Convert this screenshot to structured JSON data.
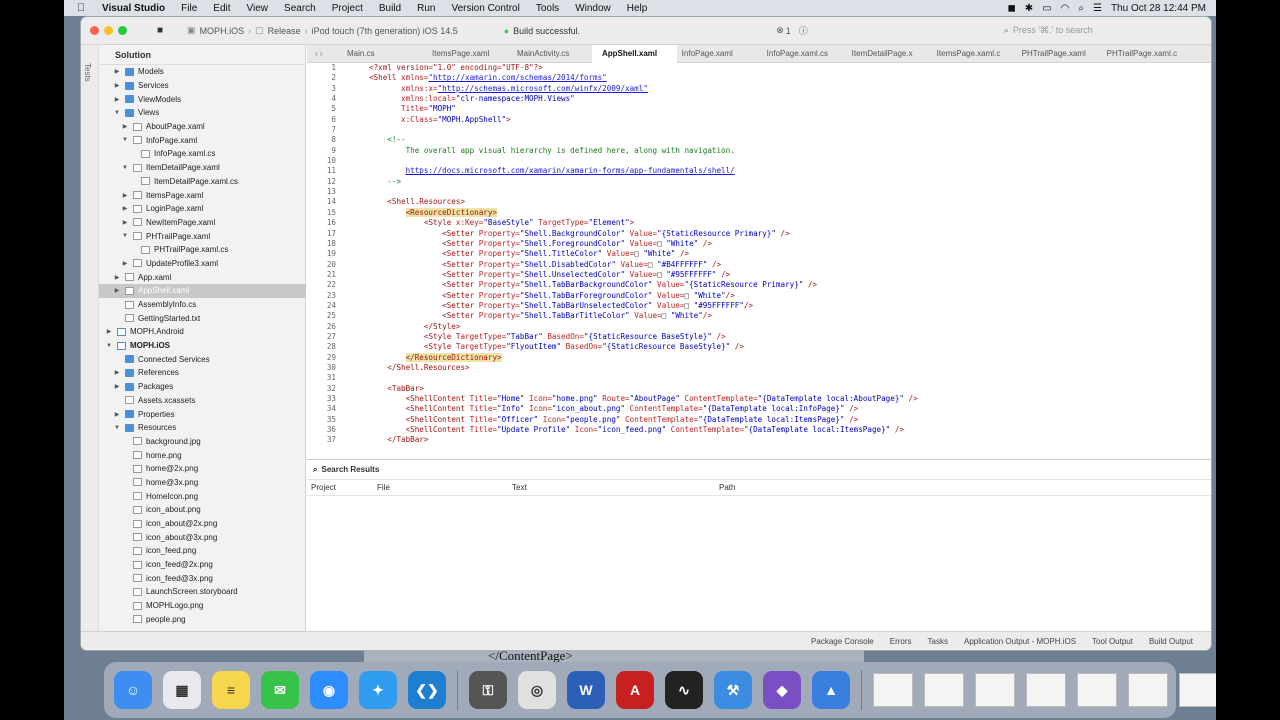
{
  "menubar": {
    "items": [
      "Visual Studio",
      "File",
      "Edit",
      "View",
      "Search",
      "Project",
      "Build",
      "Run",
      "Version Control",
      "Tools",
      "Window",
      "Help"
    ],
    "clock": "Thu Oct 28  12:44 PM"
  },
  "toolbar": {
    "project": "MOPH.iOS",
    "config": "Release",
    "device": "iPod touch (7th generation) iOS 14.5",
    "status": "Build successful.",
    "errors": "1",
    "search_placeholder": "Press '⌘.' to search"
  },
  "sidebar": {
    "vtab": "Tests",
    "title": "Solution",
    "tree": [
      {
        "label": "Models",
        "level": 1,
        "type": "folder",
        "arrow": "right"
      },
      {
        "label": "Services",
        "level": 1,
        "type": "folder",
        "arrow": "right"
      },
      {
        "label": "ViewModels",
        "level": 1,
        "type": "folder",
        "arrow": "right"
      },
      {
        "label": "Views",
        "level": 1,
        "type": "folder",
        "arrow": "down"
      },
      {
        "label": "AboutPage.xaml",
        "level": 2,
        "type": "file",
        "arrow": "right"
      },
      {
        "label": "InfoPage.xaml",
        "level": 2,
        "type": "file",
        "arrow": "down"
      },
      {
        "label": "InfoPage.xaml.cs",
        "level": 3,
        "type": "file",
        "arrow": ""
      },
      {
        "label": "ItemDetailPage.xaml",
        "level": 2,
        "type": "file",
        "arrow": "down"
      },
      {
        "label": "ItemDetailPage.xaml.cs",
        "level": 3,
        "type": "file",
        "arrow": ""
      },
      {
        "label": "ItemsPage.xaml",
        "level": 2,
        "type": "file",
        "arrow": "right"
      },
      {
        "label": "LoginPage.xaml",
        "level": 2,
        "type": "file",
        "arrow": "right"
      },
      {
        "label": "NewItemPage.xaml",
        "level": 2,
        "type": "file",
        "arrow": "right"
      },
      {
        "label": "PHTrailPage.xaml",
        "level": 2,
        "type": "file",
        "arrow": "down"
      },
      {
        "label": "PHTrailPage.xaml.cs",
        "level": 3,
        "type": "file",
        "arrow": ""
      },
      {
        "label": "UpdateProfile3.xaml",
        "level": 2,
        "type": "file",
        "arrow": "right"
      },
      {
        "label": "App.xaml",
        "level": 1,
        "type": "file",
        "arrow": "right"
      },
      {
        "label": "AppShell.xaml",
        "level": 1,
        "type": "file",
        "arrow": "right",
        "selected": true
      },
      {
        "label": "AssemblyInfo.cs",
        "level": 1,
        "type": "file",
        "arrow": ""
      },
      {
        "label": "GettingStarted.txt",
        "level": 1,
        "type": "file",
        "arrow": ""
      },
      {
        "label": "MOPH.Android",
        "level": 0,
        "type": "proj",
        "arrow": "right"
      },
      {
        "label": "MOPH.iOS",
        "level": 0,
        "type": "proj",
        "arrow": "down",
        "bold": true
      },
      {
        "label": "Connected Services",
        "level": 1,
        "type": "folder",
        "arrow": ""
      },
      {
        "label": "References",
        "level": 1,
        "type": "folder",
        "arrow": "right"
      },
      {
        "label": "Packages",
        "level": 1,
        "type": "folder",
        "arrow": "right"
      },
      {
        "label": "Assets.xcassets",
        "level": 1,
        "type": "file",
        "arrow": ""
      },
      {
        "label": "Properties",
        "level": 1,
        "type": "folder",
        "arrow": "right"
      },
      {
        "label": "Resources",
        "level": 1,
        "type": "folder",
        "arrow": "down"
      },
      {
        "label": "background.jpg",
        "level": 2,
        "type": "file",
        "arrow": ""
      },
      {
        "label": "home.png",
        "level": 2,
        "type": "file",
        "arrow": ""
      },
      {
        "label": "home@2x.png",
        "level": 2,
        "type": "file",
        "arrow": ""
      },
      {
        "label": "home@3x.png",
        "level": 2,
        "type": "file",
        "arrow": ""
      },
      {
        "label": "HomeIcon.png",
        "level": 2,
        "type": "file",
        "arrow": ""
      },
      {
        "label": "icon_about.png",
        "level": 2,
        "type": "file",
        "arrow": ""
      },
      {
        "label": "icon_about@2x.png",
        "level": 2,
        "type": "file",
        "arrow": ""
      },
      {
        "label": "icon_about@3x.png",
        "level": 2,
        "type": "file",
        "arrow": ""
      },
      {
        "label": "icon_feed.png",
        "level": 2,
        "type": "file",
        "arrow": ""
      },
      {
        "label": "icon_feed@2x.png",
        "level": 2,
        "type": "file",
        "arrow": ""
      },
      {
        "label": "icon_feed@3x.png",
        "level": 2,
        "type": "file",
        "arrow": ""
      },
      {
        "label": "LaunchScreen.storyboard",
        "level": 2,
        "type": "file",
        "arrow": ""
      },
      {
        "label": "MOPHLogo.png",
        "level": 2,
        "type": "file",
        "arrow": ""
      },
      {
        "label": "people.png",
        "level": 2,
        "type": "file",
        "arrow": ""
      }
    ]
  },
  "tabs": [
    {
      "label": "Main.cs"
    },
    {
      "label": "ItemsPage.xaml"
    },
    {
      "label": "MainActivity.cs"
    },
    {
      "label": "AppShell.xaml",
      "active": true
    },
    {
      "label": "InfoPage.xaml"
    },
    {
      "label": "InfoPage.xaml.cs"
    },
    {
      "label": "ItemDetailPage.x"
    },
    {
      "label": "ItemsPage.xaml.c"
    },
    {
      "label": "PHTrailPage.xaml"
    },
    {
      "label": "PHTrailPage.xaml.c"
    }
  ],
  "code": [
    {
      "n": "1",
      "i": 0,
      "s": [
        [
          "t",
          "<?xml version=\"1.0\" encoding=\"UTF-8\"?>"
        ]
      ]
    },
    {
      "n": "2",
      "i": 0,
      "s": [
        [
          "t",
          "<Shell "
        ],
        [
          "a",
          "xmlns="
        ],
        [
          "u",
          "\"http://xamarin.com/schemas/2014/forms\""
        ]
      ]
    },
    {
      "n": "3",
      "i": 7,
      "s": [
        [
          "a",
          "xmlns:x="
        ],
        [
          "u",
          "\"http://schemas.microsoft.com/winfx/2009/xaml\""
        ]
      ]
    },
    {
      "n": "4",
      "i": 7,
      "s": [
        [
          "a",
          "xmlns:local="
        ],
        [
          "v",
          "\"clr-namespace:MOPH.Views\""
        ]
      ]
    },
    {
      "n": "5",
      "i": 7,
      "s": [
        [
          "a",
          "Title="
        ],
        [
          "v",
          "\"MOPH\""
        ]
      ]
    },
    {
      "n": "6",
      "i": 7,
      "s": [
        [
          "a",
          "x:Class="
        ],
        [
          "v",
          "\"MOPH.AppShell\""
        ],
        [
          "t",
          ">"
        ]
      ]
    },
    {
      "n": "7",
      "i": 0,
      "s": []
    },
    {
      "n": "8",
      "i": 4,
      "s": [
        [
          "c",
          "<!--"
        ]
      ]
    },
    {
      "n": "9",
      "i": 8,
      "s": [
        [
          "c",
          "The overall app visual hierarchy is defined here, along with navigation."
        ]
      ]
    },
    {
      "n": "10",
      "i": 0,
      "s": []
    },
    {
      "n": "11",
      "i": 8,
      "s": [
        [
          "u",
          "https://docs.microsoft.com/xamarin/xamarin-forms/app-fundamentals/shell/"
        ]
      ]
    },
    {
      "n": "12",
      "i": 4,
      "s": [
        [
          "c",
          "-->"
        ]
      ]
    },
    {
      "n": "13",
      "i": 0,
      "s": []
    },
    {
      "n": "14",
      "i": 4,
      "s": [
        [
          "t",
          "<Shell.Resources>"
        ]
      ]
    },
    {
      "n": "15",
      "i": 8,
      "s": [
        [
          "h",
          "<ResourceDictionary>"
        ]
      ]
    },
    {
      "n": "16",
      "i": 12,
      "s": [
        [
          "t",
          "<Style "
        ],
        [
          "a",
          "x:Key="
        ],
        [
          "v",
          "\"BaseStyle\" "
        ],
        [
          "a",
          "TargetType="
        ],
        [
          "v",
          "\"Element\""
        ],
        [
          "t",
          ">"
        ]
      ]
    },
    {
      "n": "17",
      "i": 16,
      "s": [
        [
          "t",
          "<Setter "
        ],
        [
          "a",
          "Property="
        ],
        [
          "v",
          "\"Shell.BackgroundColor\" "
        ],
        [
          "a",
          "Value="
        ],
        [
          "v",
          "\"{StaticResource Primary}\" "
        ],
        [
          "t",
          "/>"
        ]
      ]
    },
    {
      "n": "18",
      "i": 16,
      "s": [
        [
          "t",
          "<Setter "
        ],
        [
          "a",
          "Property="
        ],
        [
          "v",
          "\"Shell.ForegroundColor\" "
        ],
        [
          "a",
          "Value="
        ],
        [
          "p",
          "□ "
        ],
        [
          "v",
          "\"White\" "
        ],
        [
          "t",
          "/>"
        ]
      ]
    },
    {
      "n": "19",
      "i": 16,
      "s": [
        [
          "t",
          "<Setter "
        ],
        [
          "a",
          "Property="
        ],
        [
          "v",
          "\"Shell.TitleColor\" "
        ],
        [
          "a",
          "Value="
        ],
        [
          "p",
          "□ "
        ],
        [
          "v",
          "\"White\" "
        ],
        [
          "t",
          "/>"
        ]
      ]
    },
    {
      "n": "20",
      "i": 16,
      "s": [
        [
          "t",
          "<Setter "
        ],
        [
          "a",
          "Property="
        ],
        [
          "v",
          "\"Shell.DisabledColor\" "
        ],
        [
          "a",
          "Value="
        ],
        [
          "p",
          "□ "
        ],
        [
          "v",
          "\"#B4FFFFFF\" "
        ],
        [
          "t",
          "/>"
        ]
      ]
    },
    {
      "n": "21",
      "i": 16,
      "s": [
        [
          "t",
          "<Setter "
        ],
        [
          "a",
          "Property="
        ],
        [
          "v",
          "\"Shell.UnselectedColor\" "
        ],
        [
          "a",
          "Value="
        ],
        [
          "p",
          "□ "
        ],
        [
          "v",
          "\"#95FFFFFF\" "
        ],
        [
          "t",
          "/>"
        ]
      ]
    },
    {
      "n": "22",
      "i": 16,
      "s": [
        [
          "t",
          "<Setter "
        ],
        [
          "a",
          "Property="
        ],
        [
          "v",
          "\"Shell.TabBarBackgroundColor\" "
        ],
        [
          "a",
          "Value="
        ],
        [
          "v",
          "\"{StaticResource Primary}\" "
        ],
        [
          "t",
          "/>"
        ]
      ]
    },
    {
      "n": "23",
      "i": 16,
      "s": [
        [
          "t",
          "<Setter "
        ],
        [
          "a",
          "Property="
        ],
        [
          "v",
          "\"Shell.TabBarForegroundColor\" "
        ],
        [
          "a",
          "Value="
        ],
        [
          "p",
          "□ "
        ],
        [
          "v",
          "\"White\""
        ],
        [
          "t",
          "/>"
        ]
      ]
    },
    {
      "n": "24",
      "i": 16,
      "s": [
        [
          "t",
          "<Setter "
        ],
        [
          "a",
          "Property="
        ],
        [
          "v",
          "\"Shell.TabBarUnselectedColor\" "
        ],
        [
          "a",
          "Value="
        ],
        [
          "p",
          "□ "
        ],
        [
          "v",
          "\"#95FFFFFF\""
        ],
        [
          "t",
          "/>"
        ]
      ]
    },
    {
      "n": "25",
      "i": 16,
      "s": [
        [
          "t",
          "<Setter "
        ],
        [
          "a",
          "Property="
        ],
        [
          "v",
          "\"Shell.TabBarTitleColor\" "
        ],
        [
          "a",
          "Value="
        ],
        [
          "p",
          "□ "
        ],
        [
          "v",
          "\"White\""
        ],
        [
          "t",
          "/>"
        ]
      ]
    },
    {
      "n": "26",
      "i": 12,
      "s": [
        [
          "t",
          "</Style>"
        ]
      ]
    },
    {
      "n": "27",
      "i": 12,
      "s": [
        [
          "t",
          "<Style "
        ],
        [
          "a",
          "TargetType="
        ],
        [
          "v",
          "\"TabBar\" "
        ],
        [
          "a",
          "BasedOn="
        ],
        [
          "v",
          "\"{StaticResource BaseStyle}\" "
        ],
        [
          "t",
          "/>"
        ]
      ]
    },
    {
      "n": "28",
      "i": 12,
      "s": [
        [
          "t",
          "<Style "
        ],
        [
          "a",
          "TargetType="
        ],
        [
          "v",
          "\"FlyoutItem\" "
        ],
        [
          "a",
          "BasedOn="
        ],
        [
          "v",
          "\"{StaticResource BaseStyle}\" "
        ],
        [
          "t",
          "/>"
        ]
      ]
    },
    {
      "n": "29",
      "i": 8,
      "s": [
        [
          "h",
          "</ResourceDictionary>"
        ]
      ]
    },
    {
      "n": "30",
      "i": 4,
      "s": [
        [
          "t",
          "</Shell.Resources>"
        ]
      ]
    },
    {
      "n": "31",
      "i": 0,
      "s": []
    },
    {
      "n": "32",
      "i": 4,
      "s": [
        [
          "t",
          "<TabBar>"
        ]
      ]
    },
    {
      "n": "33",
      "i": 8,
      "s": [
        [
          "t",
          "<ShellContent "
        ],
        [
          "a",
          "Title="
        ],
        [
          "v",
          "\"Home\" "
        ],
        [
          "a",
          "Icon="
        ],
        [
          "v",
          "\"home.png\" "
        ],
        [
          "a",
          "Route="
        ],
        [
          "v",
          "\"AboutPage\" "
        ],
        [
          "a",
          "ContentTemplate="
        ],
        [
          "v",
          "\"{DataTemplate local:AboutPage}\" "
        ],
        [
          "t",
          "/>"
        ]
      ]
    },
    {
      "n": "34",
      "i": 8,
      "s": [
        [
          "t",
          "<ShellContent "
        ],
        [
          "a",
          "Title="
        ],
        [
          "v",
          "\"Info\" "
        ],
        [
          "a",
          "Icon="
        ],
        [
          "v",
          "\"icon_about.png\" "
        ],
        [
          "a",
          "ContentTemplate="
        ],
        [
          "v",
          "\"{DataTemplate local:InfoPage}\" "
        ],
        [
          "t",
          "/>"
        ]
      ]
    },
    {
      "n": "35",
      "i": 8,
      "s": [
        [
          "t",
          "<ShellContent "
        ],
        [
          "a",
          "Title="
        ],
        [
          "v",
          "\"Officer\" "
        ],
        [
          "a",
          "Icon="
        ],
        [
          "v",
          "\"people.png\" "
        ],
        [
          "a",
          "ContentTemplate="
        ],
        [
          "v",
          "\"{DataTemplate local:ItemsPage}\" "
        ],
        [
          "t",
          "/>"
        ]
      ]
    },
    {
      "n": "36",
      "i": 8,
      "s": [
        [
          "t",
          "<ShellContent "
        ],
        [
          "a",
          "Title="
        ],
        [
          "v",
          "\"Update Profile\" "
        ],
        [
          "a",
          "Icon="
        ],
        [
          "v",
          "\"icon_feed.png\" "
        ],
        [
          "a",
          "ContentTemplate="
        ],
        [
          "v",
          "\"{DataTemplate local:ItemsPage}\" "
        ],
        [
          "t",
          "/>"
        ]
      ]
    },
    {
      "n": "37",
      "i": 4,
      "s": [
        [
          "t",
          "</TabBar>"
        ]
      ]
    }
  ],
  "search": {
    "title": "Search Results",
    "columns": [
      "Project",
      "File",
      "Text",
      "Path"
    ]
  },
  "statusbar": {
    "items": [
      "Package Console",
      "Errors",
      "Tasks",
      "Application Output - MOPH.iOS",
      "Tool Output",
      "Build Output"
    ]
  },
  "behind_text": "</ContentPage>",
  "dock": [
    {
      "name": "finder-icon",
      "color": "#3d8ef0",
      "glyph": "☺"
    },
    {
      "name": "launchpad-icon",
      "color": "#e8e8ee",
      "glyph": "▦"
    },
    {
      "name": "notes-icon",
      "color": "#f5d64e",
      "glyph": "≡"
    },
    {
      "name": "messages-icon",
      "color": "#37c24a",
      "glyph": "✉"
    },
    {
      "name": "zoom-icon",
      "color": "#2d8cff",
      "glyph": "◉"
    },
    {
      "name": "safari-icon",
      "color": "#2f9cf0",
      "glyph": "✦"
    },
    {
      "name": "vscode-icon",
      "color": "#1e7fd0",
      "glyph": "❮❯"
    },
    {
      "name": "keychain-icon",
      "color": "#555555",
      "glyph": "⚿"
    },
    {
      "name": "chrome-icon",
      "color": "#e0e0e0",
      "glyph": "◎"
    },
    {
      "name": "word-icon",
      "color": "#2b5fb8",
      "glyph": "W"
    },
    {
      "name": "acrobat-icon",
      "color": "#c8201f",
      "glyph": "A"
    },
    {
      "name": "activity-monitor-icon",
      "color": "#222222",
      "glyph": "∿"
    },
    {
      "name": "xcode-icon",
      "color": "#3a8de0",
      "glyph": "⚒"
    },
    {
      "name": "visual-studio-icon",
      "color": "#7b4fc4",
      "glyph": "◆"
    },
    {
      "name": "simulator-icon",
      "color": "#3a7fe0",
      "glyph": "▲"
    }
  ],
  "dock_thumbs": 7
}
